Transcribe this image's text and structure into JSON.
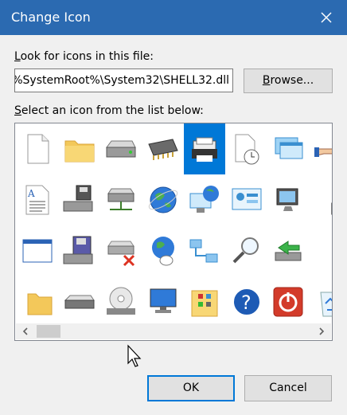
{
  "window": {
    "title": "Change Icon",
    "close_icon": "close-icon"
  },
  "file_section": {
    "label_prefix_u": "L",
    "label_rest": "ook for icons in this file:",
    "path_value": "%SystemRoot%\\System32\\SHELL32.dll",
    "browse_u": "B",
    "browse_rest": "rowse..."
  },
  "list_section": {
    "label_prefix_u": "S",
    "label_rest": "elect an icon from the list below:",
    "selected_index": 4,
    "icons": [
      "blank-document-icon",
      "folder-icon",
      "hard-drive-icon",
      "memory-chip-icon",
      "printer-icon",
      "clock-document-icon",
      "window-cascade-icon",
      "hand-share-icon",
      "text-document-icon",
      "floppy-drive-icon",
      "network-drive-icon",
      "globe-icon",
      "network-globe-icon",
      "control-panel-icon",
      "display-settings-icon",
      "shortcut-arrow-icon",
      "application-window-icon",
      "floppy-save-icon",
      "disconnected-drive-icon",
      "globe-mouse-icon",
      "network-computers-icon",
      "magnifier-icon",
      "drive-green-arrow-icon",
      "shutdown-small-icon",
      "folder-partial-icon",
      "drive-icon",
      "cd-drive-icon",
      "computer-monitor-icon",
      "folder-grid-icon",
      "help-icon",
      "power-icon",
      "recycle-bin-icon"
    ]
  },
  "buttons": {
    "ok": "OK",
    "cancel": "Cancel"
  },
  "colors": {
    "titlebar": "#2b6ab1",
    "selection": "#0078d7",
    "button_default_border": "#0078d7"
  }
}
